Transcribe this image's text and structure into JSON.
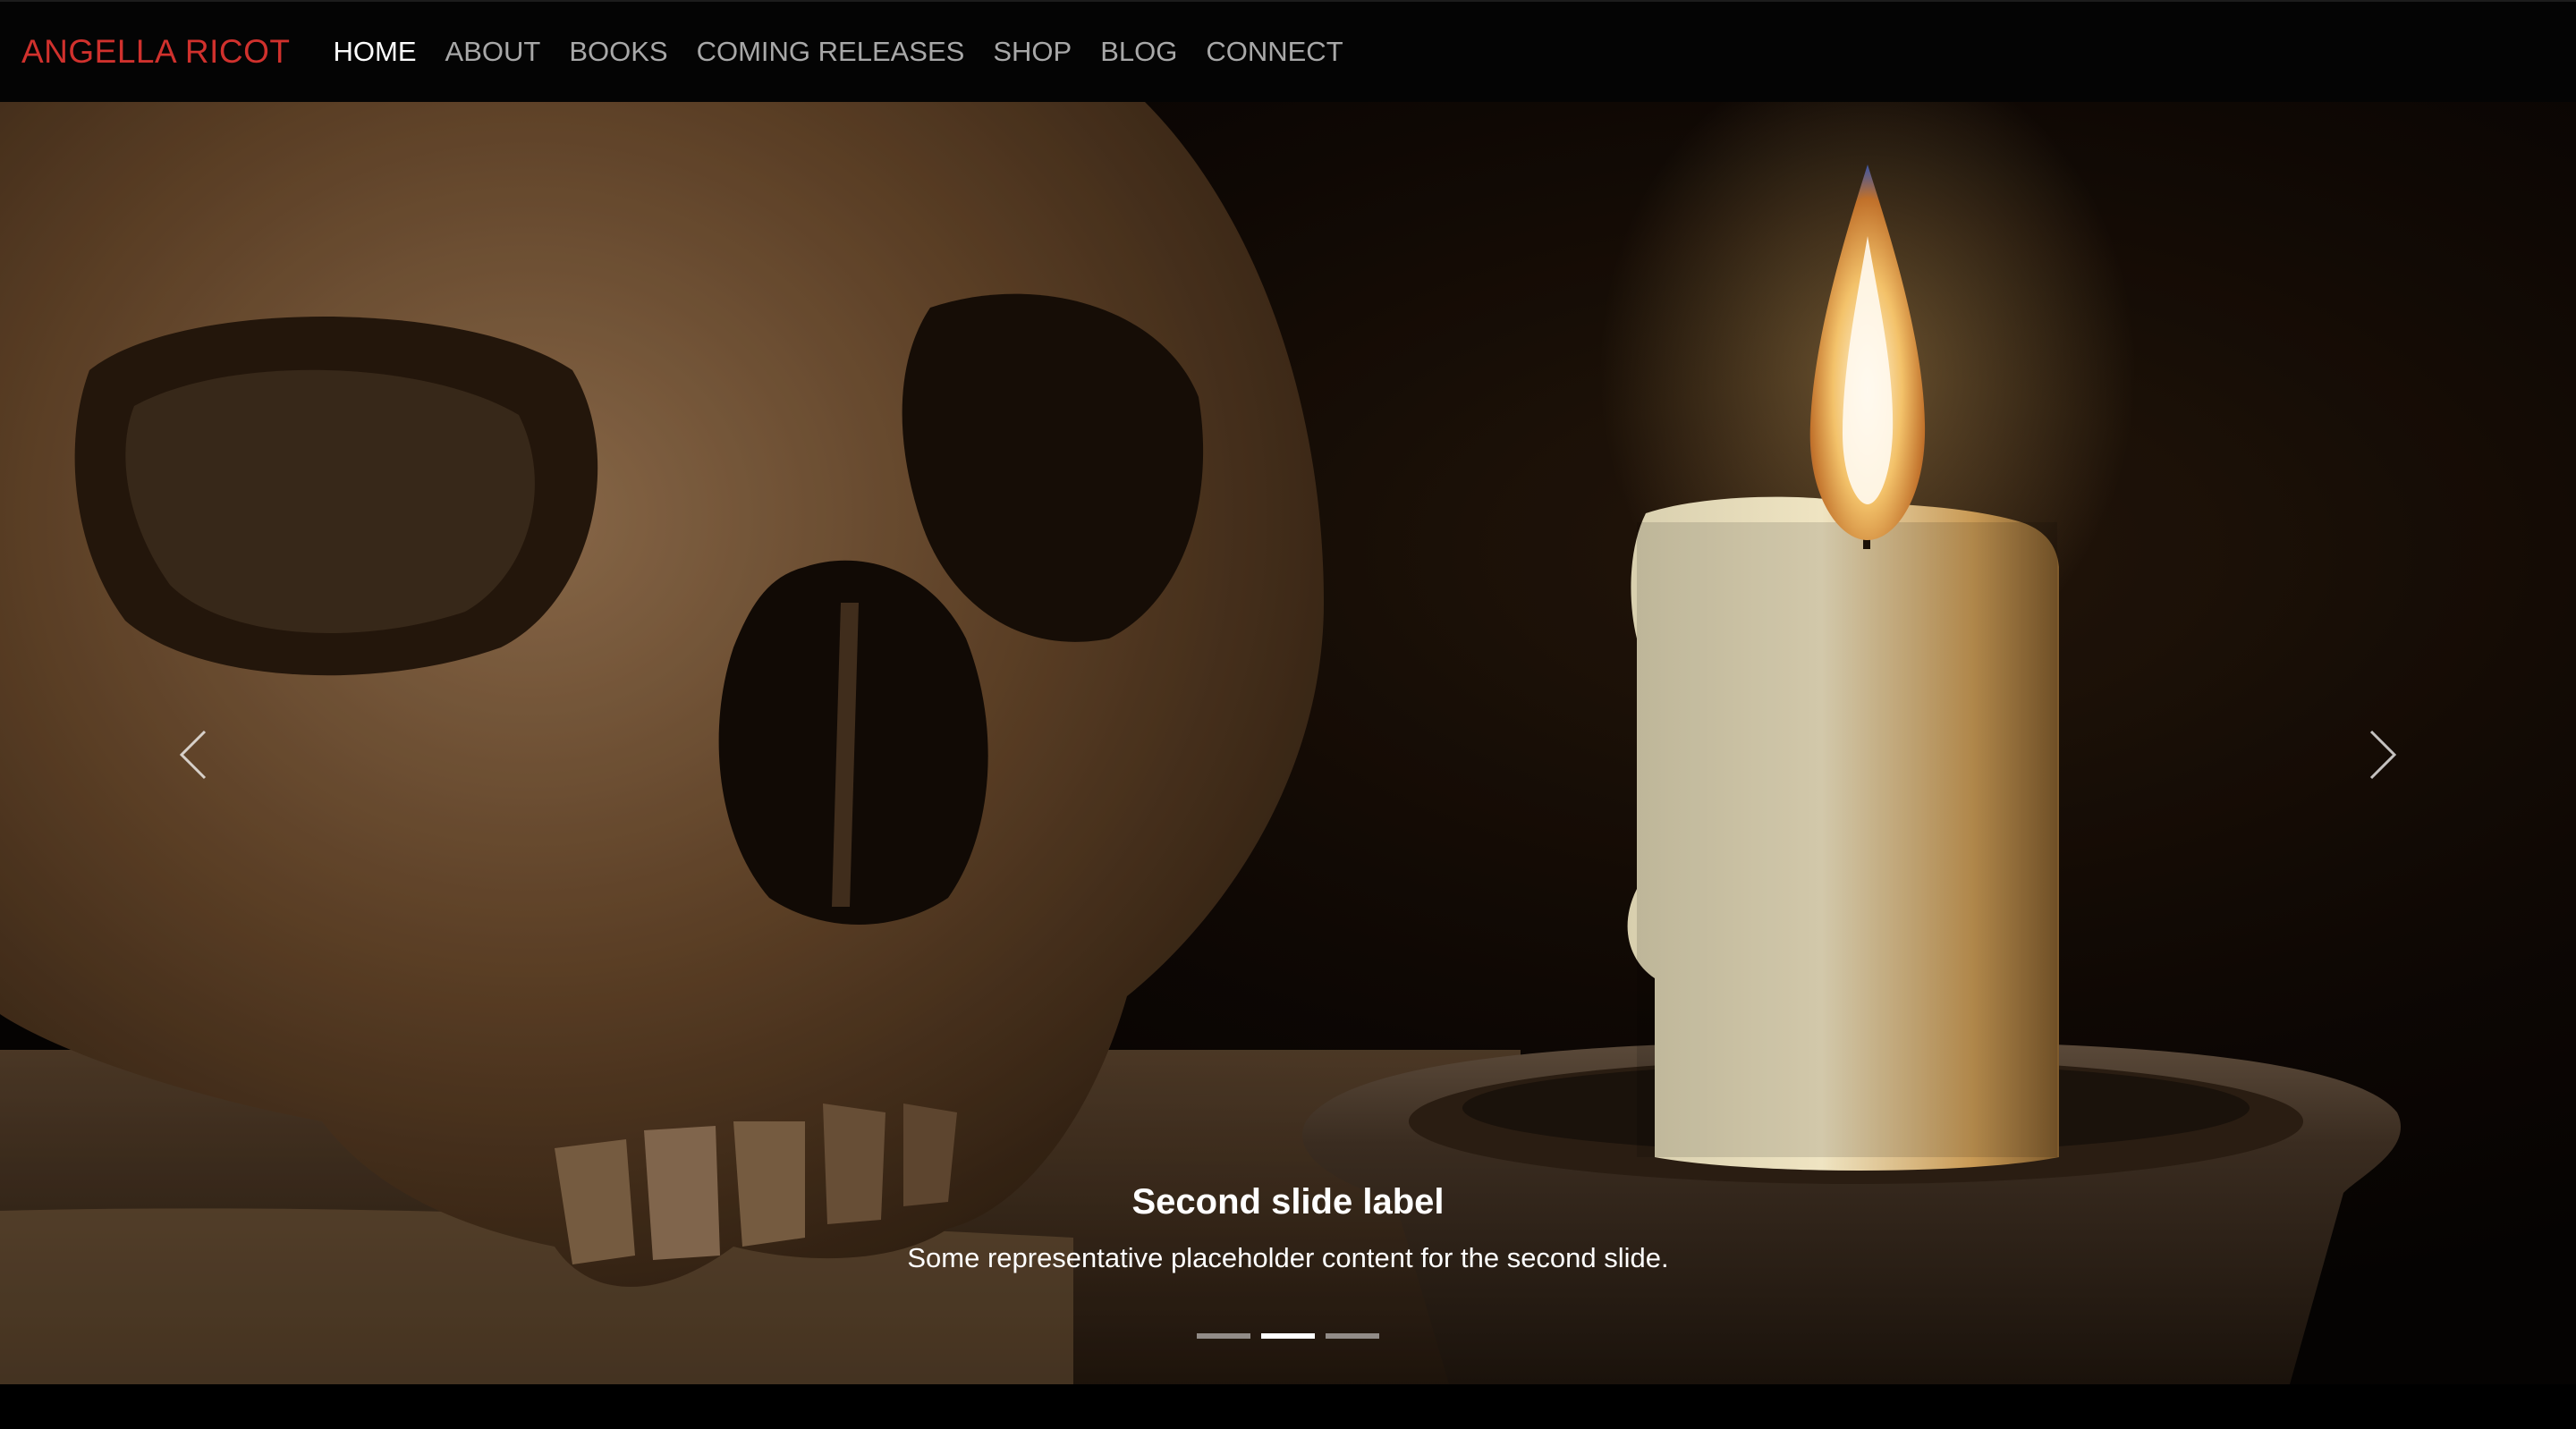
{
  "brand": {
    "name": "ANGELLA RICOT",
    "color": "#d0312d"
  },
  "nav": {
    "items": [
      {
        "label": "HOME",
        "active": true
      },
      {
        "label": "ABOUT"
      },
      {
        "label": "BOOKS"
      },
      {
        "label": "COMING RELEASES"
      },
      {
        "label": "SHOP"
      },
      {
        "label": "BLOG"
      },
      {
        "label": "CONNECT"
      }
    ]
  },
  "carousel": {
    "image_subject": "skull and lit candle",
    "caption_title": "Second slide label",
    "caption_text": "Some representative placeholder content for the second slide.",
    "active_slide": 2,
    "slide_count": 3,
    "prev_icon": "chevron-left-icon",
    "next_icon": "chevron-right-icon"
  }
}
